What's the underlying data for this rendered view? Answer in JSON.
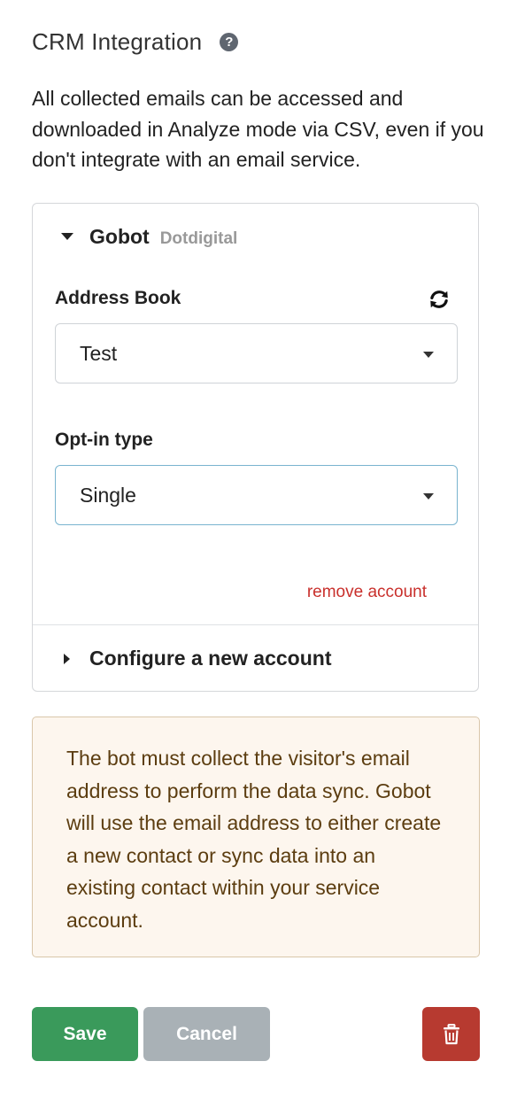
{
  "header": {
    "title": "CRM Integration",
    "help_icon": "question-circle-icon"
  },
  "intro_text": "All collected emails can be accessed and downloaded in Analyze mode via CSV, even if you don't integrate with an email service.",
  "account": {
    "name": "Gobot",
    "service": "Dotdigital",
    "address_book": {
      "label": "Address Book",
      "value": "Test",
      "refresh_icon": "refresh-icon"
    },
    "opt_in": {
      "label": "Opt-in type",
      "value": "Single"
    },
    "remove_label": "remove account"
  },
  "configure_label": "Configure a new account",
  "notice_text": "The bot must collect the visitor's email address to perform the data sync. Gobot will use the email address to either create a new contact or sync data into an existing contact within your service account.",
  "buttons": {
    "save": "Save",
    "cancel": "Cancel",
    "delete_icon": "trash-icon"
  },
  "colors": {
    "save": "#3a9a5b",
    "cancel": "#a9b1b6",
    "delete": "#b73a30",
    "remove_link": "#c9302c",
    "notice_bg": "#fdf6ee",
    "notice_text": "#5c3d10"
  }
}
